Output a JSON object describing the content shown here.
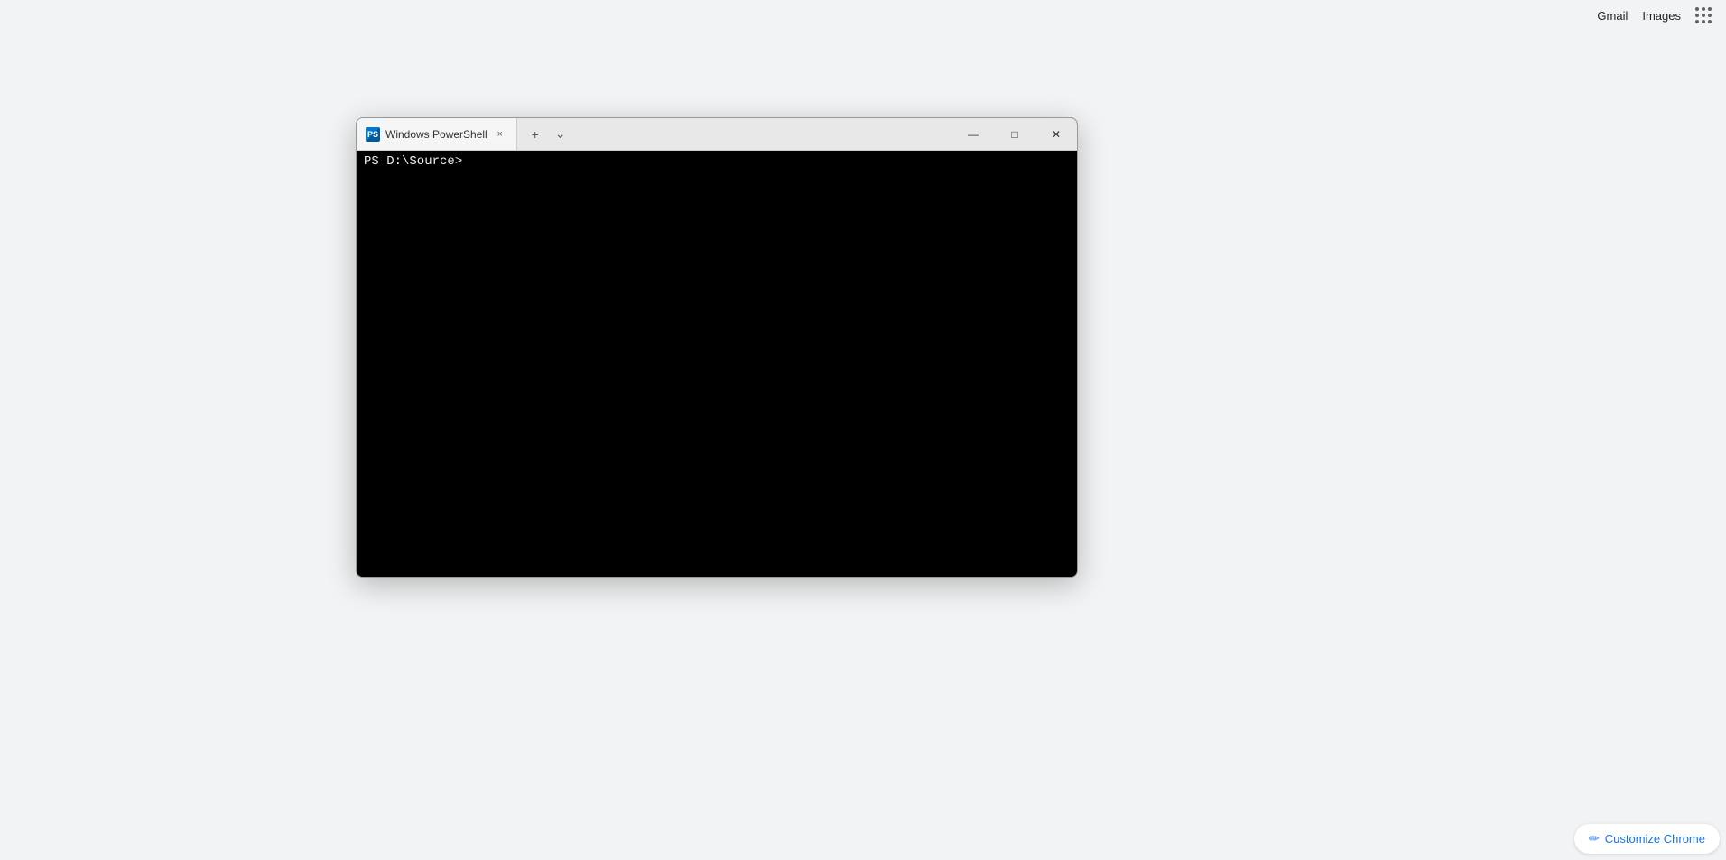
{
  "chrome": {
    "gmail_label": "Gmail",
    "images_label": "Images",
    "apps_icon_label": "Google apps"
  },
  "powershell_window": {
    "title": "Windows PowerShell",
    "tab_close_label": "×",
    "add_tab_label": "+",
    "dropdown_label": "˅",
    "minimize_label": "—",
    "maximize_label": "□",
    "close_label": "✕",
    "prompt_text": "PS D:\\Source>"
  },
  "customize_chrome": {
    "label": "Customize Chrome"
  }
}
